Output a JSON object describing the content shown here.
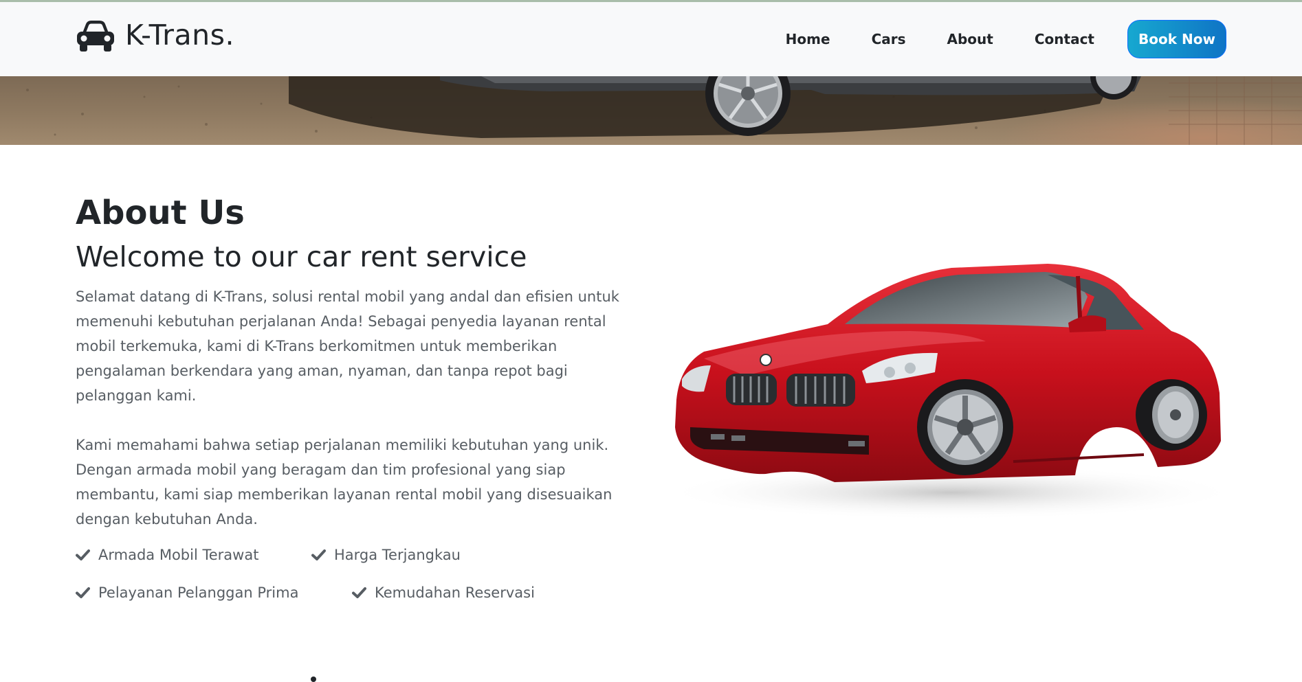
{
  "brand": {
    "name": "K-Trans.",
    "icon": "car-icon"
  },
  "nav": {
    "items": [
      {
        "label": "Home"
      },
      {
        "label": "Cars"
      },
      {
        "label": "About"
      },
      {
        "label": "Contact"
      }
    ],
    "cta_label": "Book Now"
  },
  "about": {
    "heading": "About Us",
    "subheading": "Welcome to our car rent service",
    "paragraph_1": "Selamat datang di K-Trans, solusi rental mobil yang andal dan efisien untuk memenuhi kebutuhan perjalanan Anda! Sebagai penyedia layanan rental mobil terkemuka, kami di K-Trans berkomitmen untuk memberikan pengalaman berkendara yang aman, nyaman, dan tanpa repot bagi pelanggan kami.",
    "paragraph_2": "Kami memahami bahwa setiap perjalanan memiliki kebutuhan yang unik. Dengan armada mobil yang beragam dan tim profesional yang siap membantu, kami siap memberikan layanan rental mobil yang disesuaikan dengan kebutuhan Anda.",
    "features": [
      {
        "label": "Armada Mobil Terawat",
        "icon": "check-icon"
      },
      {
        "label": "Harga Terjangkau",
        "icon": "check-icon"
      },
      {
        "label": "Pelayanan Pelanggan Prima",
        "icon": "check-icon"
      },
      {
        "label": "Kemudahan Reservasi",
        "icon": "check-icon"
      }
    ]
  },
  "colors": {
    "cta_gradient_start": "#17a8d0",
    "cta_gradient_end": "#0f74c5",
    "text_dark": "#212529",
    "text_muted": "#575d63",
    "navbar_bg": "#f8f9fa",
    "car_red": "#c8101c"
  }
}
